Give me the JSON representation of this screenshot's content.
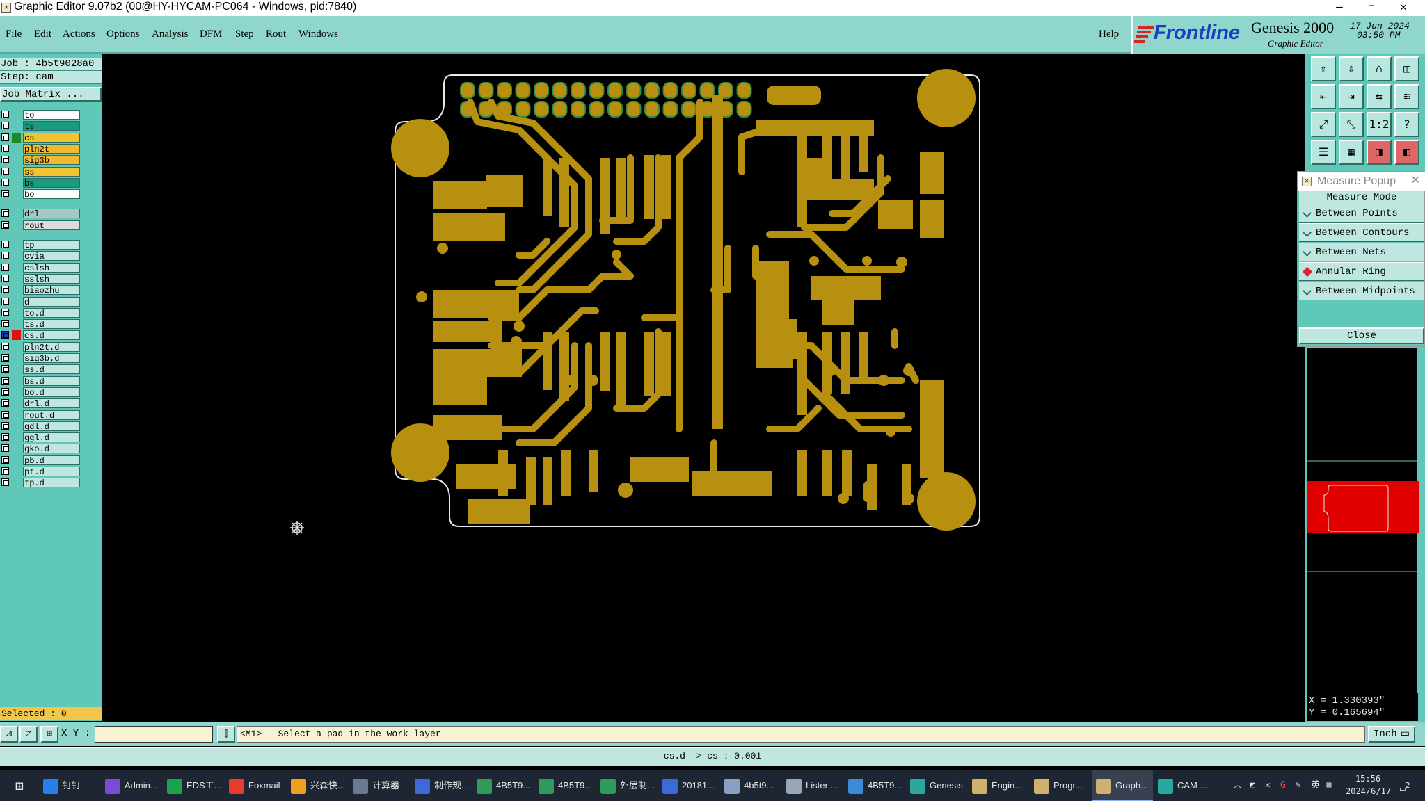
{
  "window": {
    "title": "Graphic Editor 9.07b2 (00@HY-HYCAM-PC064 - Windows, pid:7840)",
    "minimize_glyph": "—",
    "maximize_glyph": "☐",
    "close_glyph": "✕"
  },
  "menu": {
    "items": [
      "File",
      "Edit",
      "Actions",
      "Options",
      "Analysis",
      "DFM",
      "Step",
      "Rout",
      "Windows"
    ],
    "help": "Help"
  },
  "logo": {
    "brand": "Frontline",
    "product": "Genesis 2000",
    "subtitle": "Graphic Editor",
    "date": "17 Jun 2024",
    "time": "03:50 PM"
  },
  "job": {
    "job_line": "Job : 4b5t9028a0",
    "step_line": "Step: cam",
    "matrix_button": "Job Matrix ..."
  },
  "layers": [
    {
      "name": "to",
      "color": "#ffffff"
    },
    {
      "name": "ts",
      "color": "#1a9a7e"
    },
    {
      "name": "cs",
      "color": "#f2c230",
      "marker": "#1d8a2a"
    },
    {
      "name": "pln2t",
      "color": "#f2b830"
    },
    {
      "name": "sig3b",
      "color": "#f2b830"
    },
    {
      "name": "ss",
      "color": "#f2c230"
    },
    {
      "name": "bs",
      "color": "#1a9a7e"
    },
    {
      "name": "bo",
      "color": "#ffffff"
    },
    {
      "name": "drl",
      "color": "#a8c8c8"
    },
    {
      "name": "rout",
      "color": "#dcdcdc"
    },
    {
      "name": "tp",
      "color": "#bfe7df"
    },
    {
      "name": "cvia",
      "color": "#bfe7df"
    },
    {
      "name": "cslsh",
      "color": "#bfe7df"
    },
    {
      "name": "sslsh",
      "color": "#bfe7df"
    },
    {
      "name": "biaozhu",
      "color": "#bfe7df"
    },
    {
      "name": "d",
      "color": "#bfe7df"
    },
    {
      "name": "to.d",
      "color": "#bfe7df"
    },
    {
      "name": "ts.d",
      "color": "#bfe7df"
    },
    {
      "name": "cs.d",
      "color": "#bfe7df",
      "marker": "#e01010",
      "work": true
    },
    {
      "name": "pln2t.d",
      "color": "#bfe7df"
    },
    {
      "name": "sig3b.d",
      "color": "#bfe7df"
    },
    {
      "name": "ss.d",
      "color": "#bfe7df"
    },
    {
      "name": "bs.d",
      "color": "#bfe7df"
    },
    {
      "name": "bo.d",
      "color": "#bfe7df"
    },
    {
      "name": "drl.d",
      "color": "#bfe7df"
    },
    {
      "name": "rout.d",
      "color": "#bfe7df"
    },
    {
      "name": "gdl.d",
      "color": "#bfe7df"
    },
    {
      "name": "ggl.d",
      "color": "#bfe7df"
    },
    {
      "name": "gko.d",
      "color": "#bfe7df"
    },
    {
      "name": "pb.d",
      "color": "#bfe7df"
    },
    {
      "name": "pt.d",
      "color": "#bfe7df"
    },
    {
      "name": "tp.d",
      "color": "#bfe7df"
    }
  ],
  "selected": "Selected : 0",
  "measure": {
    "title": "Measure Popup",
    "mode_label": "Measure Mode",
    "options": [
      "Between Points",
      "Between Contours",
      "Between Nets",
      "Annular Ring",
      "Between Midpoints"
    ],
    "active_option": "Annular Ring",
    "close": "Close"
  },
  "coords": {
    "x": "X = 1.330393\"",
    "y": "Y = 0.165694\""
  },
  "cmd": {
    "xy_label": "X Y :",
    "xy_value": "",
    "prompt": "<M1> - Select a pad in the work layer",
    "unit": "Inch"
  },
  "status": "cs.d -> cs : 0.001",
  "taskbar": {
    "items": [
      {
        "label": "钉钉",
        "color": "#2b7de9"
      },
      {
        "label": "Admin...",
        "color": "#7a4bd6"
      },
      {
        "label": "EDS工...",
        "color": "#1aa34a"
      },
      {
        "label": "Foxmail",
        "color": "#e63b2e"
      },
      {
        "label": "兴森快...",
        "color": "#f0a020"
      },
      {
        "label": "计算器",
        "color": "#6a7a90"
      },
      {
        "label": "制作规...",
        "color": "#3d6ad6"
      },
      {
        "label": "4B5T9...",
        "color": "#2f9a5a"
      },
      {
        "label": "4B5T9...",
        "color": "#2f9a5a"
      },
      {
        "label": "外层制...",
        "color": "#2f9a5a"
      },
      {
        "label": "20181...",
        "color": "#3d6ad6"
      },
      {
        "label": "4b5t9...",
        "color": "#8aa0c0"
      },
      {
        "label": "Lister ...",
        "color": "#9aa5b5"
      },
      {
        "label": "4B5T9...",
        "color": "#3d8ad6"
      },
      {
        "label": "Genesis",
        "color": "#2aa8a0"
      },
      {
        "label": "Engin...",
        "color": "#d0b070"
      },
      {
        "label": "Progr...",
        "color": "#d0b070"
      },
      {
        "label": "Graph...",
        "color": "#d0b070",
        "active": true
      },
      {
        "label": "CAM ...",
        "color": "#2aa8a0"
      }
    ],
    "lang": "英",
    "time": "15:56",
    "date": "2024/6/17",
    "notif": "2"
  }
}
